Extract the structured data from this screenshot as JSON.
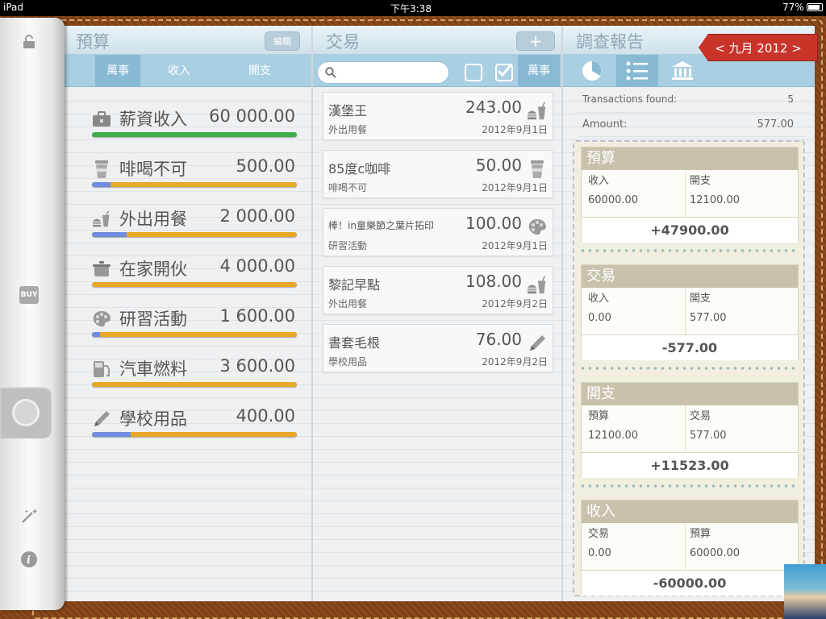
{
  "status": {
    "device": "iPad",
    "time": "下午3:38",
    "battery": "77%"
  },
  "budget": {
    "title": "預算",
    "edit": "編輯",
    "tabs": [
      "萬事",
      "收入",
      "開支"
    ],
    "items": [
      {
        "name": "薪資收入",
        "amount": "60 000.00",
        "icon": "briefcase-icon",
        "progress": 1.0,
        "color": "#3cb04a"
      },
      {
        "name": "啡喝不可",
        "amount": "500.00",
        "icon": "coffee-cup-icon",
        "progress": 0.09
      },
      {
        "name": "外出用餐",
        "amount": "2 000.00",
        "icon": "fast-food-icon",
        "progress": 0.17
      },
      {
        "name": "在家開伙",
        "amount": "4 000.00",
        "icon": "cooking-pot-icon",
        "progress": 0.0
      },
      {
        "name": "研習活動",
        "amount": "1 600.00",
        "icon": "palette-icon",
        "progress": 0.04
      },
      {
        "name": "汽車燃料",
        "amount": "3 600.00",
        "icon": "fuel-pump-icon",
        "progress": 0.0
      },
      {
        "name": "學校用品",
        "amount": "400.00",
        "icon": "pencil-icon",
        "progress": 0.19
      }
    ]
  },
  "transactions": {
    "title": "交易",
    "add": "+",
    "filter": "萬事",
    "items": [
      {
        "name": "漢堡王",
        "amount": "243.00",
        "category": "外出用餐",
        "date": "2012年9月1日",
        "icon": "fast-food-icon"
      },
      {
        "name": "85度c咖啡",
        "amount": "50.00",
        "category": "啡喝不可",
        "date": "2012年9月1日",
        "icon": "coffee-cup-icon"
      },
      {
        "name": "棒！in童樂節之葉片拓印",
        "amount": "100.00",
        "category": "研習活動",
        "date": "2012年9月1日",
        "icon": "palette-icon"
      },
      {
        "name": "黎記早點",
        "amount": "108.00",
        "category": "外出用餐",
        "date": "2012年9月2日",
        "icon": "fast-food-icon"
      },
      {
        "name": "書套毛根",
        "amount": "76.00",
        "category": "學校用品",
        "date": "2012年9月2日",
        "icon": "pencil-icon"
      }
    ]
  },
  "report": {
    "title": "調查報告",
    "month": "< 九月 2012 >",
    "found_label": "Transactions found:",
    "found_value": "5",
    "amount_label": "Amount:",
    "amount_value": "577.00",
    "cards": [
      {
        "title": "預算",
        "l1": "收入",
        "l2": "開支",
        "v1": "60000.00",
        "v2": "12100.00",
        "total": "+47900.00"
      },
      {
        "title": "交易",
        "l1": "收入",
        "l2": "開支",
        "v1": "0.00",
        "v2": "577.00",
        "total": "-577.00"
      },
      {
        "title": "開支",
        "l1": "預算",
        "l2": "交易",
        "v1": "12100.00",
        "v2": "577.00",
        "total": "+11523.00"
      },
      {
        "title": "收入",
        "l1": "交易",
        "l2": "預算",
        "v1": "0.00",
        "v2": "60000.00",
        "total": "-60000.00"
      }
    ]
  },
  "sidebar": {
    "buy": "BUY"
  }
}
